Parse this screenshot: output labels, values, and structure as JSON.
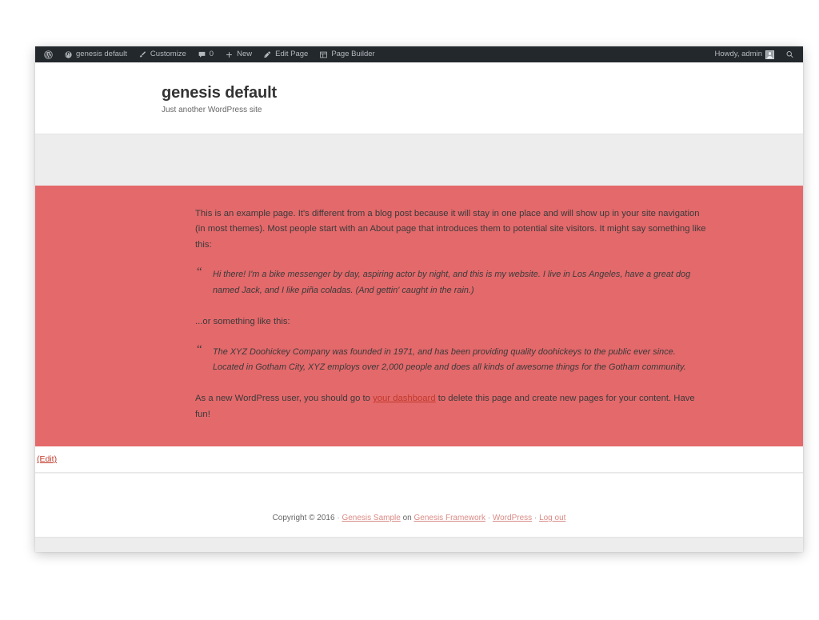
{
  "admin_bar": {
    "wp_logo": "wordpress-logo",
    "site_name": "genesis default",
    "customize": "Customize",
    "comments_count": "0",
    "new": "New",
    "edit_page": "Edit Page",
    "page_builder": "Page Builder",
    "howdy": "Howdy, admin",
    "search": "search-icon",
    "bg_color": "#23282d",
    "text_color": "#b4b9be"
  },
  "site_header": {
    "title": "genesis default",
    "description": "Just another WordPress site"
  },
  "nav": {
    "items": [],
    "bg_color": "#ededed"
  },
  "content": {
    "bg_color": "#e4696b",
    "paragraph_1": "This is an example page. It's different from a blog post because it will stay in one place and will show up in your site navigation (in most themes). Most people start with an About page that introduces them to potential site visitors. It might say something like this:",
    "quote_1": "Hi there! I'm a bike messenger by day, aspiring actor by night, and this is my website. I live in Los Angeles, have a great dog named Jack, and I like piña coladas. (And gettin' caught in the rain.)",
    "paragraph_2": "...or something like this:",
    "quote_2": "The XYZ Doohickey Company was founded in 1971, and has been providing quality doohickeys to the public ever since. Located in Gotham City, XYZ employs over 2,000 people and does all kinds of awesome things for the Gotham community.",
    "paragraph_3_before": "As a new WordPress user, you should go to ",
    "dashboard_link": "your dashboard",
    "paragraph_3_after": " to delete this page and create new pages for your content. Have fun!",
    "quote_mark": "“",
    "link_color": "#c0392b"
  },
  "edit_strip": {
    "edit_label": "(Edit)"
  },
  "footer": {
    "copyright": "Copyright © 2016",
    "sep": "·",
    "genesis_sample": "Genesis Sample",
    "on": "on",
    "genesis_framework": "Genesis Framework",
    "wordpress": "WordPress",
    "log_out": "Log out"
  }
}
